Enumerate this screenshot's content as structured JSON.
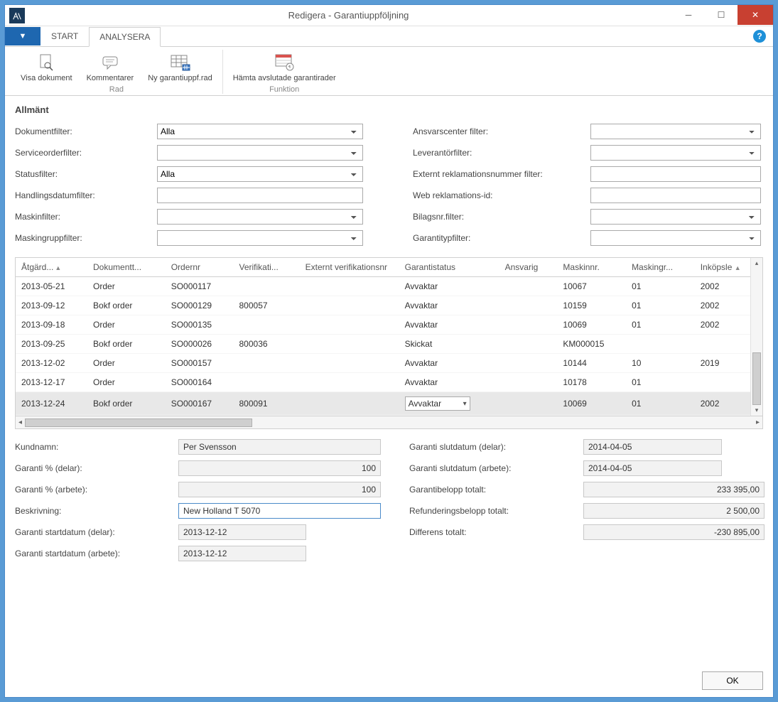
{
  "window": {
    "title": "Redigera - Garantiuppföljning"
  },
  "tabs": {
    "file_glyph": "▼",
    "start": "START",
    "analyze": "ANALYSERA"
  },
  "ribbon": {
    "group_rad": "Rad",
    "group_funktion": "Funktion",
    "view_doc": "Visa dokument",
    "comments": "Kommentarer",
    "new_row": "Ny garantiuppf.rad",
    "fetch_closed": "Hämta avslutade garantirader"
  },
  "section_allmant": "Allmänt",
  "filters": {
    "dokumentfilter_label": "Dokumentfilter:",
    "dokumentfilter_value": "Alla",
    "serviceorderfilter_label": "Serviceorderfilter:",
    "serviceorderfilter_value": "",
    "statusfilter_label": "Statusfilter:",
    "statusfilter_value": "Alla",
    "handlingsdatum_label": "Handlingsdatumfilter:",
    "handlingsdatum_value": "",
    "maskinfilter_label": "Maskinfilter:",
    "maskinfilter_value": "",
    "maskingrupp_label": "Maskingruppfilter:",
    "maskingrupp_value": "",
    "ansvarscenter_label": "Ansvarscenter filter:",
    "ansvarscenter_value": "",
    "leverantor_label": "Leverantörfilter:",
    "leverantor_value": "",
    "externtrekl_label": "Externt reklamationsnummer filter:",
    "externtrekl_value": "",
    "webrekl_label": "Web reklamations-id:",
    "webrekl_value": "",
    "bilagsnr_label": "Bilagsnr.filter:",
    "bilagsnr_value": "",
    "garantityp_label": "Garantitypfilter:",
    "garantityp_value": ""
  },
  "columns": {
    "atgard": "Åtgärd...",
    "dokumenttyp": "Dokumentt...",
    "ordernr": "Ordernr",
    "verifikation": "Verifikati...",
    "extverif": "Externt verifikationsnr",
    "garantistatus": "Garantistatus",
    "ansvarig": "Ansvarig",
    "maskinnr": "Maskinnr.",
    "maskingr": "Maskingr...",
    "inkopsle": "Inköpsle"
  },
  "rows": [
    {
      "atgard": "2013-05-21",
      "dokt": "Order",
      "ordernr": "SO000117",
      "verif": "",
      "ext": "",
      "status": "Avvaktar",
      "ansv": "",
      "maskin": "10067",
      "mg": "01",
      "ink": "2002"
    },
    {
      "atgard": "2013-09-12",
      "dokt": "Bokf order",
      "ordernr": "SO000129",
      "verif": "800057",
      "ext": "",
      "status": "Avvaktar",
      "ansv": "",
      "maskin": "10159",
      "mg": "01",
      "ink": "2002"
    },
    {
      "atgard": "2013-09-18",
      "dokt": "Order",
      "ordernr": "SO000135",
      "verif": "",
      "ext": "",
      "status": "Avvaktar",
      "ansv": "",
      "maskin": "10069",
      "mg": "01",
      "ink": "2002"
    },
    {
      "atgard": "2013-09-25",
      "dokt": "Bokf order",
      "ordernr": "SO000026",
      "verif": "800036",
      "ext": "",
      "status": "Skickat",
      "ansv": "",
      "maskin": "KM000015",
      "mg": "",
      "ink": ""
    },
    {
      "atgard": "2013-12-02",
      "dokt": "Order",
      "ordernr": "SO000157",
      "verif": "",
      "ext": "",
      "status": "Avvaktar",
      "ansv": "",
      "maskin": "10144",
      "mg": "10",
      "ink": "2019"
    },
    {
      "atgard": "2013-12-17",
      "dokt": "Order",
      "ordernr": "SO000164",
      "verif": "",
      "ext": "",
      "status": "Avvaktar",
      "ansv": "",
      "maskin": "10178",
      "mg": "01",
      "ink": ""
    },
    {
      "atgard": "2013-12-24",
      "dokt": "Bokf order",
      "ordernr": "SO000167",
      "verif": "800091",
      "ext": "",
      "status": "Avvaktar",
      "ansv": "",
      "maskin": "10069",
      "mg": "01",
      "ink": "2002",
      "selected": true
    }
  ],
  "details": {
    "kundnamn_label": "Kundnamn:",
    "kundnamn_value": "Per Svensson",
    "garanti_pct_delar_label": "Garanti % (delar):",
    "garanti_pct_delar_value": "100",
    "garanti_pct_arbete_label": "Garanti % (arbete):",
    "garanti_pct_arbete_value": "100",
    "beskrivning_label": "Beskrivning:",
    "beskrivning_value": "New Holland T 5070",
    "gstart_delar_label": "Garanti startdatum (delar):",
    "gstart_delar_value": "2013-12-12",
    "gstart_arbete_label": "Garanti startdatum (arbete):",
    "gstart_arbete_value": "2013-12-12",
    "gslut_delar_label": "Garanti slutdatum (delar):",
    "gslut_delar_value": "2014-04-05",
    "gslut_arbete_label": "Garanti slutdatum (arbete):",
    "gslut_arbete_value": "2014-04-05",
    "garantibelopp_label": "Garantibelopp totalt:",
    "garantibelopp_value": "233 395,00",
    "refund_label": "Refunderingsbelopp totalt:",
    "refund_value": "2 500,00",
    "differens_label": "Differens totalt:",
    "differens_value": "-230 895,00"
  },
  "footer": {
    "ok": "OK"
  }
}
